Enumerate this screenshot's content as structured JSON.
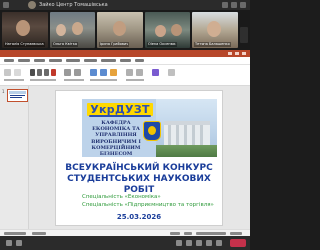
{
  "meeting": {
    "speaker_name": "Зайко Центр Томашівська"
  },
  "participants": [
    {
      "name": "Наталія Ступаєвська"
    },
    {
      "name": "Ольга Квітка"
    },
    {
      "name": "Ірина Грабович"
    },
    {
      "name": "Olena Оксенюк"
    },
    {
      "name": "Тетяна Балашенко"
    }
  ],
  "slide_panel": {
    "slide_number": "1"
  },
  "slide": {
    "logo_text": "УкрДУЗТ",
    "department_lines": [
      "КАФЕДРА",
      "ЕКОНОМІКА ТА УПРАВЛІННЯ",
      "ВИРОБНИЧИМ І КОМЕРЦІЙНИМ",
      "БІЗНЕСОМ"
    ],
    "title_line1": "ВСЕУКРАЇНСЬКИЙ КОНКУРС",
    "title_line2": "СТУДЕНТСЬКИХ НАУКОВИХ РОБІТ",
    "specialty1": "Спеціальність «Економіка»",
    "specialty2": "Спеціальність «Підприємництво та торгівля»",
    "date": "25.03.2026"
  },
  "colors": {
    "ppt_accent": "#b7472a",
    "slide_blue": "#1a3d9a",
    "slide_green": "#2e9a3a",
    "logo_yellow": "#ffd800",
    "banner_blue": "#bdd3ea",
    "leave_red": "#c4314b"
  }
}
